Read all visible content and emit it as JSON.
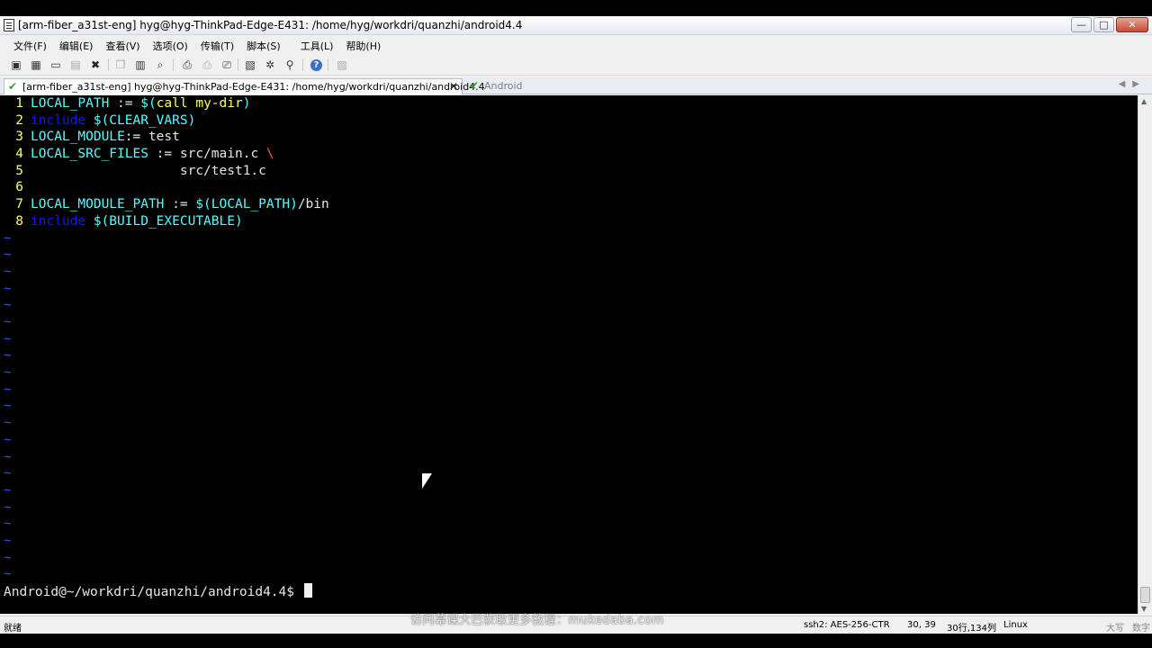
{
  "window": {
    "title": "[arm-fiber_a31st-eng] hyg@hyg-ThinkPad-Edge-E431: /home/hyg/workdri/quanzhi/android4.4",
    "minimize": "—",
    "maximize": "□",
    "close": "✕"
  },
  "menu": [
    {
      "label": "文件(F)"
    },
    {
      "label": "编辑(E)"
    },
    {
      "label": "查看(V)"
    },
    {
      "label": "选项(O)"
    },
    {
      "label": "传输(T)"
    },
    {
      "label": "脚本(S)"
    },
    {
      "label": "工具(L)"
    },
    {
      "label": "帮助(H)"
    }
  ],
  "tabs": {
    "active_label": "[arm-fiber_a31st-eng] hyg@hyg-ThinkPad-Edge-E431: /home/hyg/workdri/quanzhi/android4.4",
    "inactive_label": "Android",
    "check": "✔",
    "close": "✕",
    "arrows": "◀▶"
  },
  "editor": {
    "lines": [
      {
        "n": "1",
        "a": "LOCAL_PATH",
        "b": " := ",
        "c": "$(",
        "d": "call my-dir",
        "e": ")"
      },
      {
        "n": "2",
        "kw": "include",
        "v": " $(CLEAR_VARS)"
      },
      {
        "n": "3",
        "a": "LOCAL_MODULE",
        "b": ":= test"
      },
      {
        "n": "4",
        "a": "LOCAL_SRC_FILES",
        "b": " := src/main.c ",
        "bs": "\\"
      },
      {
        "n": "5",
        "b": "                   src/test1.c"
      },
      {
        "n": "6"
      },
      {
        "n": "7",
        "a": "LOCAL_MODULE_PATH",
        "b": " := ",
        "c": "$(LOCAL_PATH)",
        "e": "/bin"
      },
      {
        "n": "8",
        "kw": "include",
        "v": " $(BUILD_EXECUTABLE)"
      }
    ],
    "tilde": "~",
    "prompt": "Android@~/workdri/quanzhi/android4.4$ "
  },
  "status": {
    "ready": "就绪",
    "ssh": "ssh2: AES-256-CTR",
    "cursor_pos": "30, 39",
    "rows_cols": "30行,134列",
    "os": "Linux",
    "caps": "大写",
    "num": "数字",
    "watermark": "访问幕课大巴获取更多教程：mukedaba.com"
  }
}
